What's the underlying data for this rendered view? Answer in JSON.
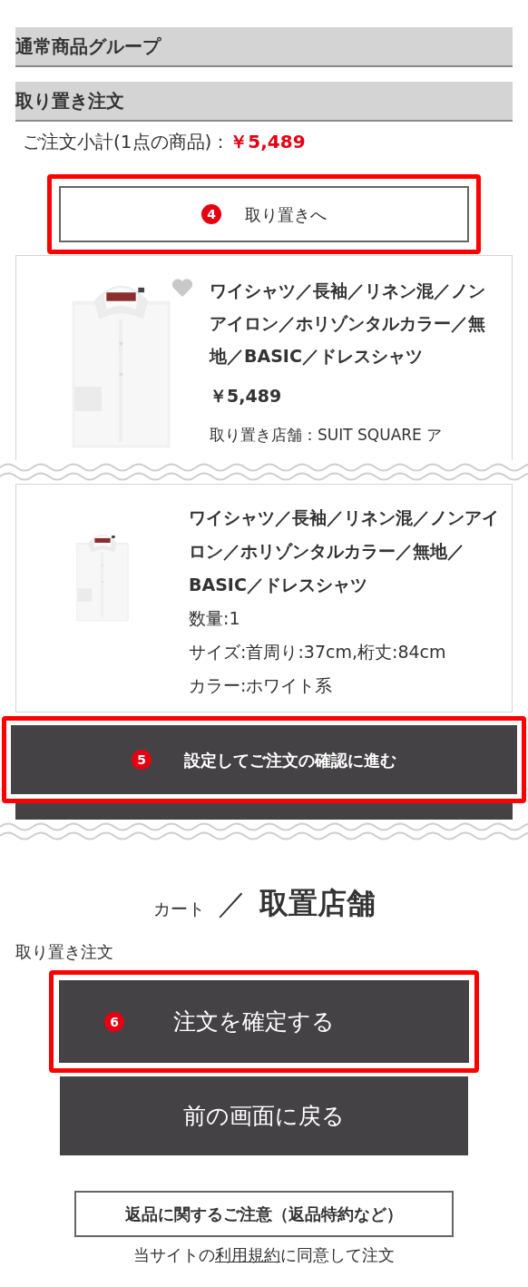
{
  "sections": [
    {
      "title": "通常商品グループ"
    },
    {
      "title": "取り置き注文"
    }
  ],
  "subtotal": {
    "label": "ご注文小計(1点の商品)：",
    "amount": "￥5,489"
  },
  "reserve_button": {
    "label": "取り置きへ",
    "step": "4",
    "highlighted": true
  },
  "products": [
    {
      "kind": "summary",
      "favorite": false,
      "title": "ワイシャツ／長袖／リネン混／ノンアイロン／ホリゾンタルカラー／無地／BASIC／ドレスシャツ",
      "price": "￥5,489",
      "store": "取り置き店舗：SUIT SQUARE ア"
    },
    {
      "kind": "detail",
      "title": "ワイシャツ／長袖／リネン混／ノンアイロン／ホリゾンタルカラー／無地／BASIC／ドレスシャツ",
      "quantity": "数量:1",
      "size": "サイズ:首周り:37cm,桁丈:84cm",
      "color_name": "カラー:ホワイト系"
    }
  ],
  "proceed_button": {
    "label": "設定してご注文の確認に進む",
    "step": "5",
    "highlighted": true
  },
  "page_heading": {
    "breadcrumb": "カート",
    "separator": "／",
    "title": "取置店舗"
  },
  "order_label": "取り置き注文",
  "confirm_button": {
    "label": "注文を確定する",
    "step": "6",
    "highlighted": true
  },
  "back_button": {
    "label": "前の画面に戻る"
  },
  "returns_button": {
    "label": "返品に関するご注意（返品特約など）"
  },
  "agreement": {
    "before": "当サイトの",
    "link": "利用規約",
    "after": "に同意して注文"
  }
}
